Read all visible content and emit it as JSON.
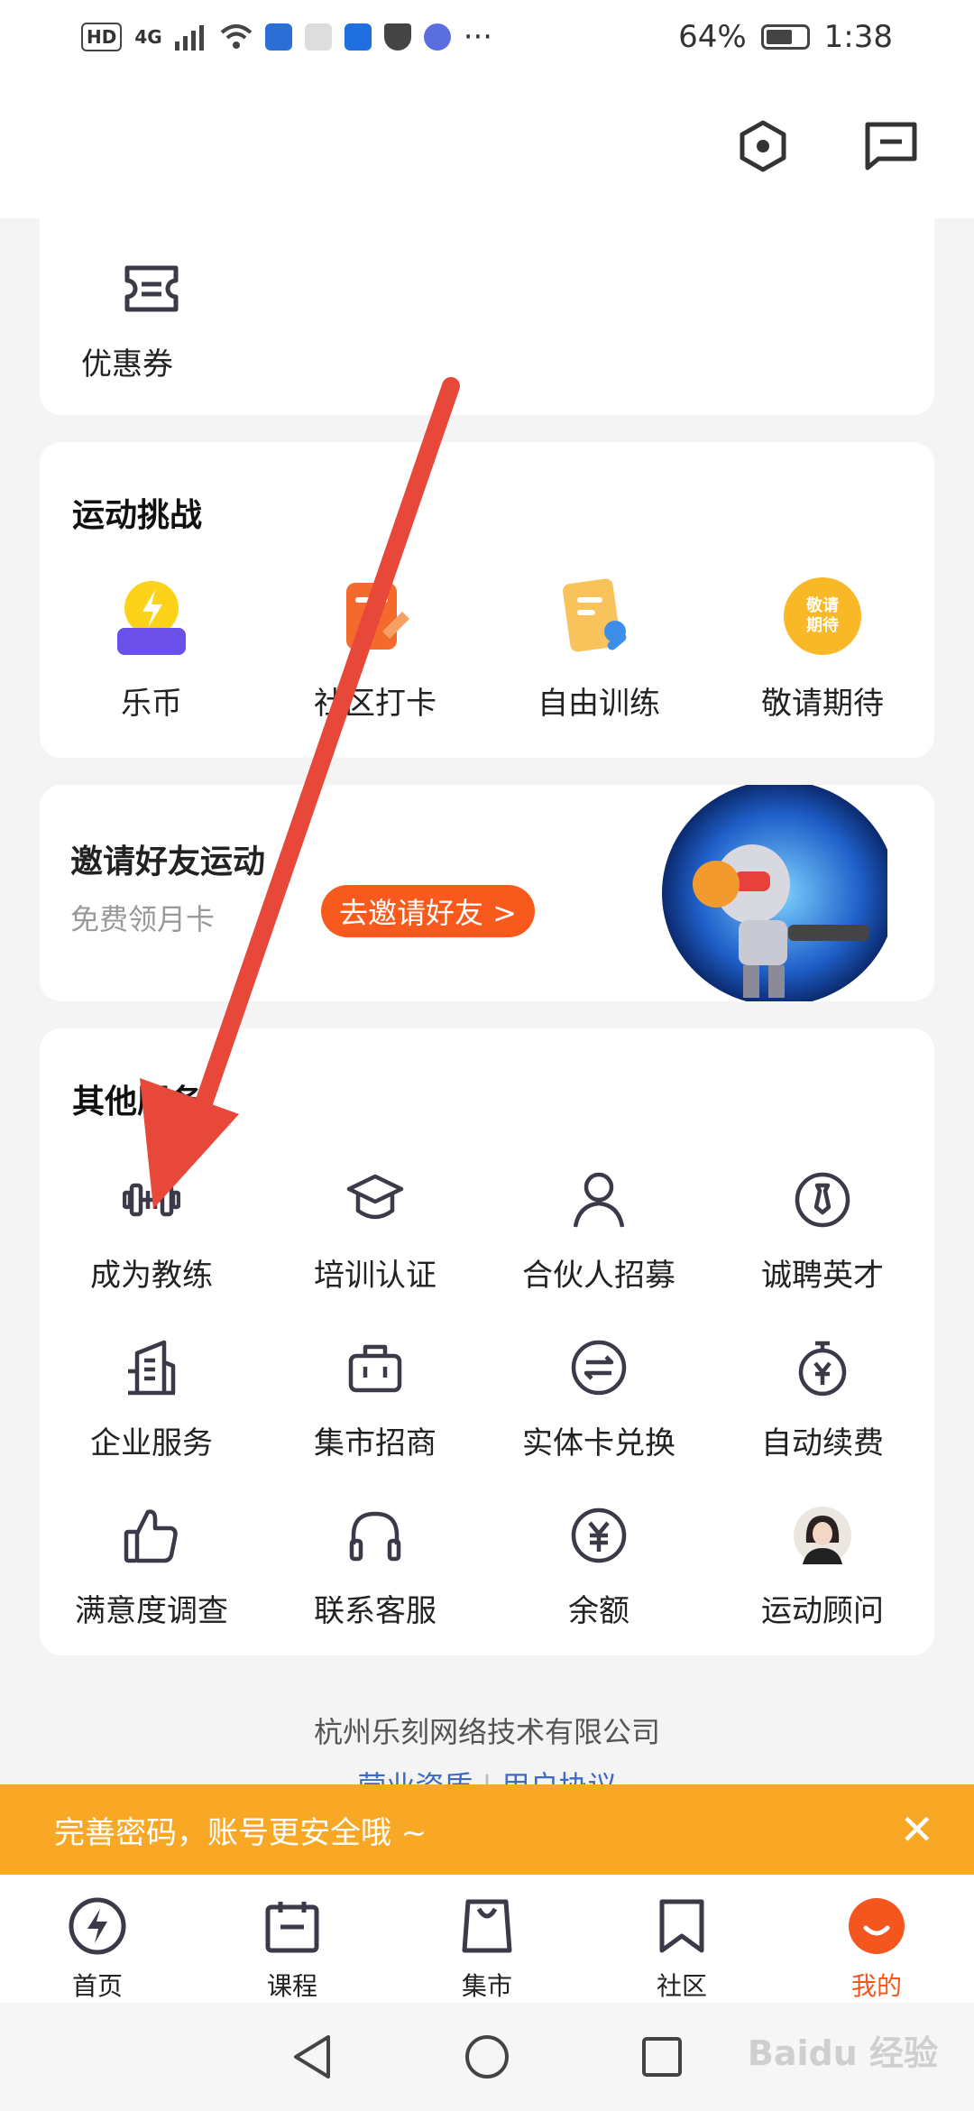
{
  "status_bar": {
    "network_badge": "HD",
    "signal_label": "4G",
    "battery_percent": "64%",
    "time": "1:38",
    "more": "···"
  },
  "coupon": {
    "label": "优惠券"
  },
  "challenge": {
    "title": "运动挑战",
    "items": [
      {
        "label": "乐币",
        "icon": "coin-icon"
      },
      {
        "label": "社区打卡",
        "icon": "checkin-icon"
      },
      {
        "label": "自由训练",
        "icon": "training-icon"
      },
      {
        "label": "敬请期待",
        "icon": "coming-soon-icon",
        "badge": "敬请期待"
      }
    ]
  },
  "invite": {
    "title": "邀请好友运动",
    "subtitle": "免费领月卡",
    "button": "去邀请好友 >"
  },
  "services": {
    "title": "其他服务",
    "items": [
      {
        "label": "成为教练",
        "icon": "dumbbell-icon"
      },
      {
        "label": "培训认证",
        "icon": "graduation-cap-icon"
      },
      {
        "label": "合伙人招募",
        "icon": "person-icon"
      },
      {
        "label": "诚聘英才",
        "icon": "tie-icon"
      },
      {
        "label": "企业服务",
        "icon": "building-icon"
      },
      {
        "label": "集市招商",
        "icon": "briefcase-icon"
      },
      {
        "label": "实体卡兑换",
        "icon": "exchange-icon"
      },
      {
        "label": "自动续费",
        "icon": "auto-renew-icon"
      },
      {
        "label": "满意度调查",
        "icon": "thumbs-up-icon"
      },
      {
        "label": "联系客服",
        "icon": "headset-icon"
      },
      {
        "label": "余额",
        "icon": "yuan-icon"
      },
      {
        "label": "运动顾问",
        "icon": "advisor-avatar"
      }
    ]
  },
  "footer": {
    "company": "杭州乐刻网络技术有限公司",
    "link_1": "营业资质",
    "link_2": "用户协议"
  },
  "banner": {
    "text": "完善密码，账号更安全哦 ~",
    "close": "✕"
  },
  "tabbar": {
    "tabs": [
      {
        "label": "首页"
      },
      {
        "label": "课程"
      },
      {
        "label": "集市"
      },
      {
        "label": "社区"
      },
      {
        "label": "我的"
      }
    ]
  },
  "watermark": "Baidu 经验",
  "colors": {
    "accent": "#f5561e",
    "banner": "#f9a825",
    "link": "#3b6bc4",
    "arrow": "#e8483a"
  }
}
